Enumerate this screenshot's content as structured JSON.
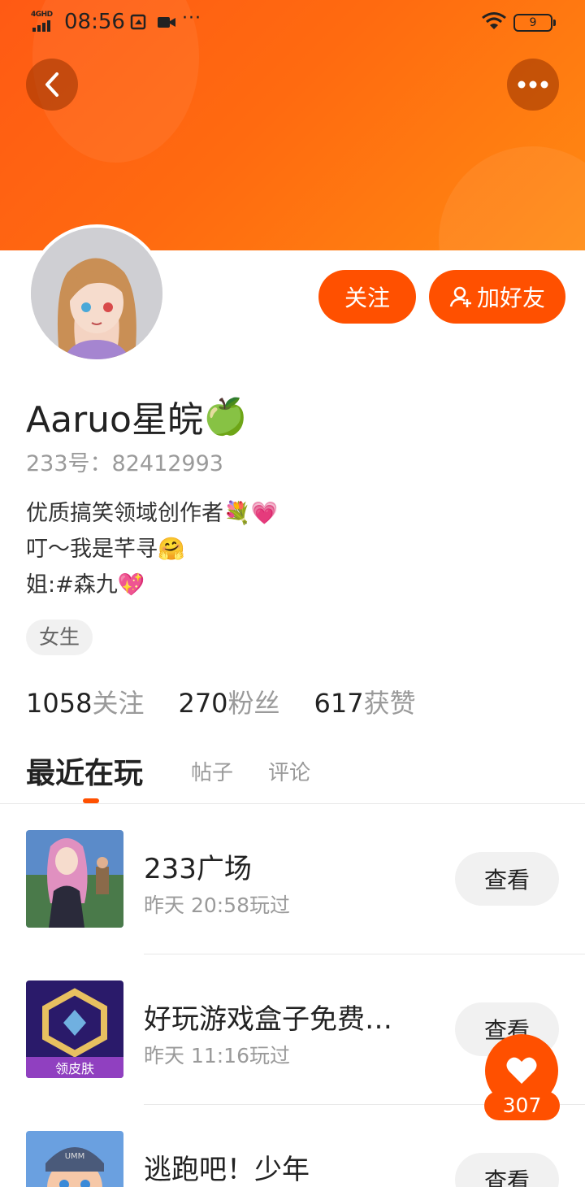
{
  "status_bar": {
    "network": "4GHD",
    "time": "08:56",
    "more": "···",
    "battery": "9"
  },
  "profile": {
    "name": "Aaruo星皖",
    "name_emoji": "🍏",
    "uid": "233号：82412993",
    "bio": [
      {
        "text": "优质搞笑领域创作者",
        "emoji": "💐💗"
      },
      {
        "text": "叮～我是芊寻",
        "emoji": "🤗"
      },
      {
        "text": "姐:#森九",
        "emoji": "💖"
      }
    ],
    "gender_tag": "女生"
  },
  "actions": {
    "follow": "关注",
    "add_friend": "加好友"
  },
  "stats": [
    {
      "value": "1058",
      "label": "关注"
    },
    {
      "value": "270",
      "label": "粉丝"
    },
    {
      "value": "617",
      "label": "获赞"
    }
  ],
  "tabs": [
    "最近在玩",
    "帖子",
    "评论"
  ],
  "games": [
    {
      "title": "233广场",
      "time": "昨天 20:58玩过",
      "action": "查看"
    },
    {
      "title": "好玩游戏盒子免费…",
      "time": "昨天 11:16玩过",
      "action": "查看",
      "thumb_text": "领皮肤"
    },
    {
      "title": "逃跑吧！少年",
      "time": "",
      "action": "查看",
      "thumb_text": "UMM"
    }
  ],
  "like": {
    "count": "307"
  },
  "colors": {
    "accent": "#ff5000",
    "banner_start": "#ff5a14",
    "banner_end": "#ff8a12"
  }
}
